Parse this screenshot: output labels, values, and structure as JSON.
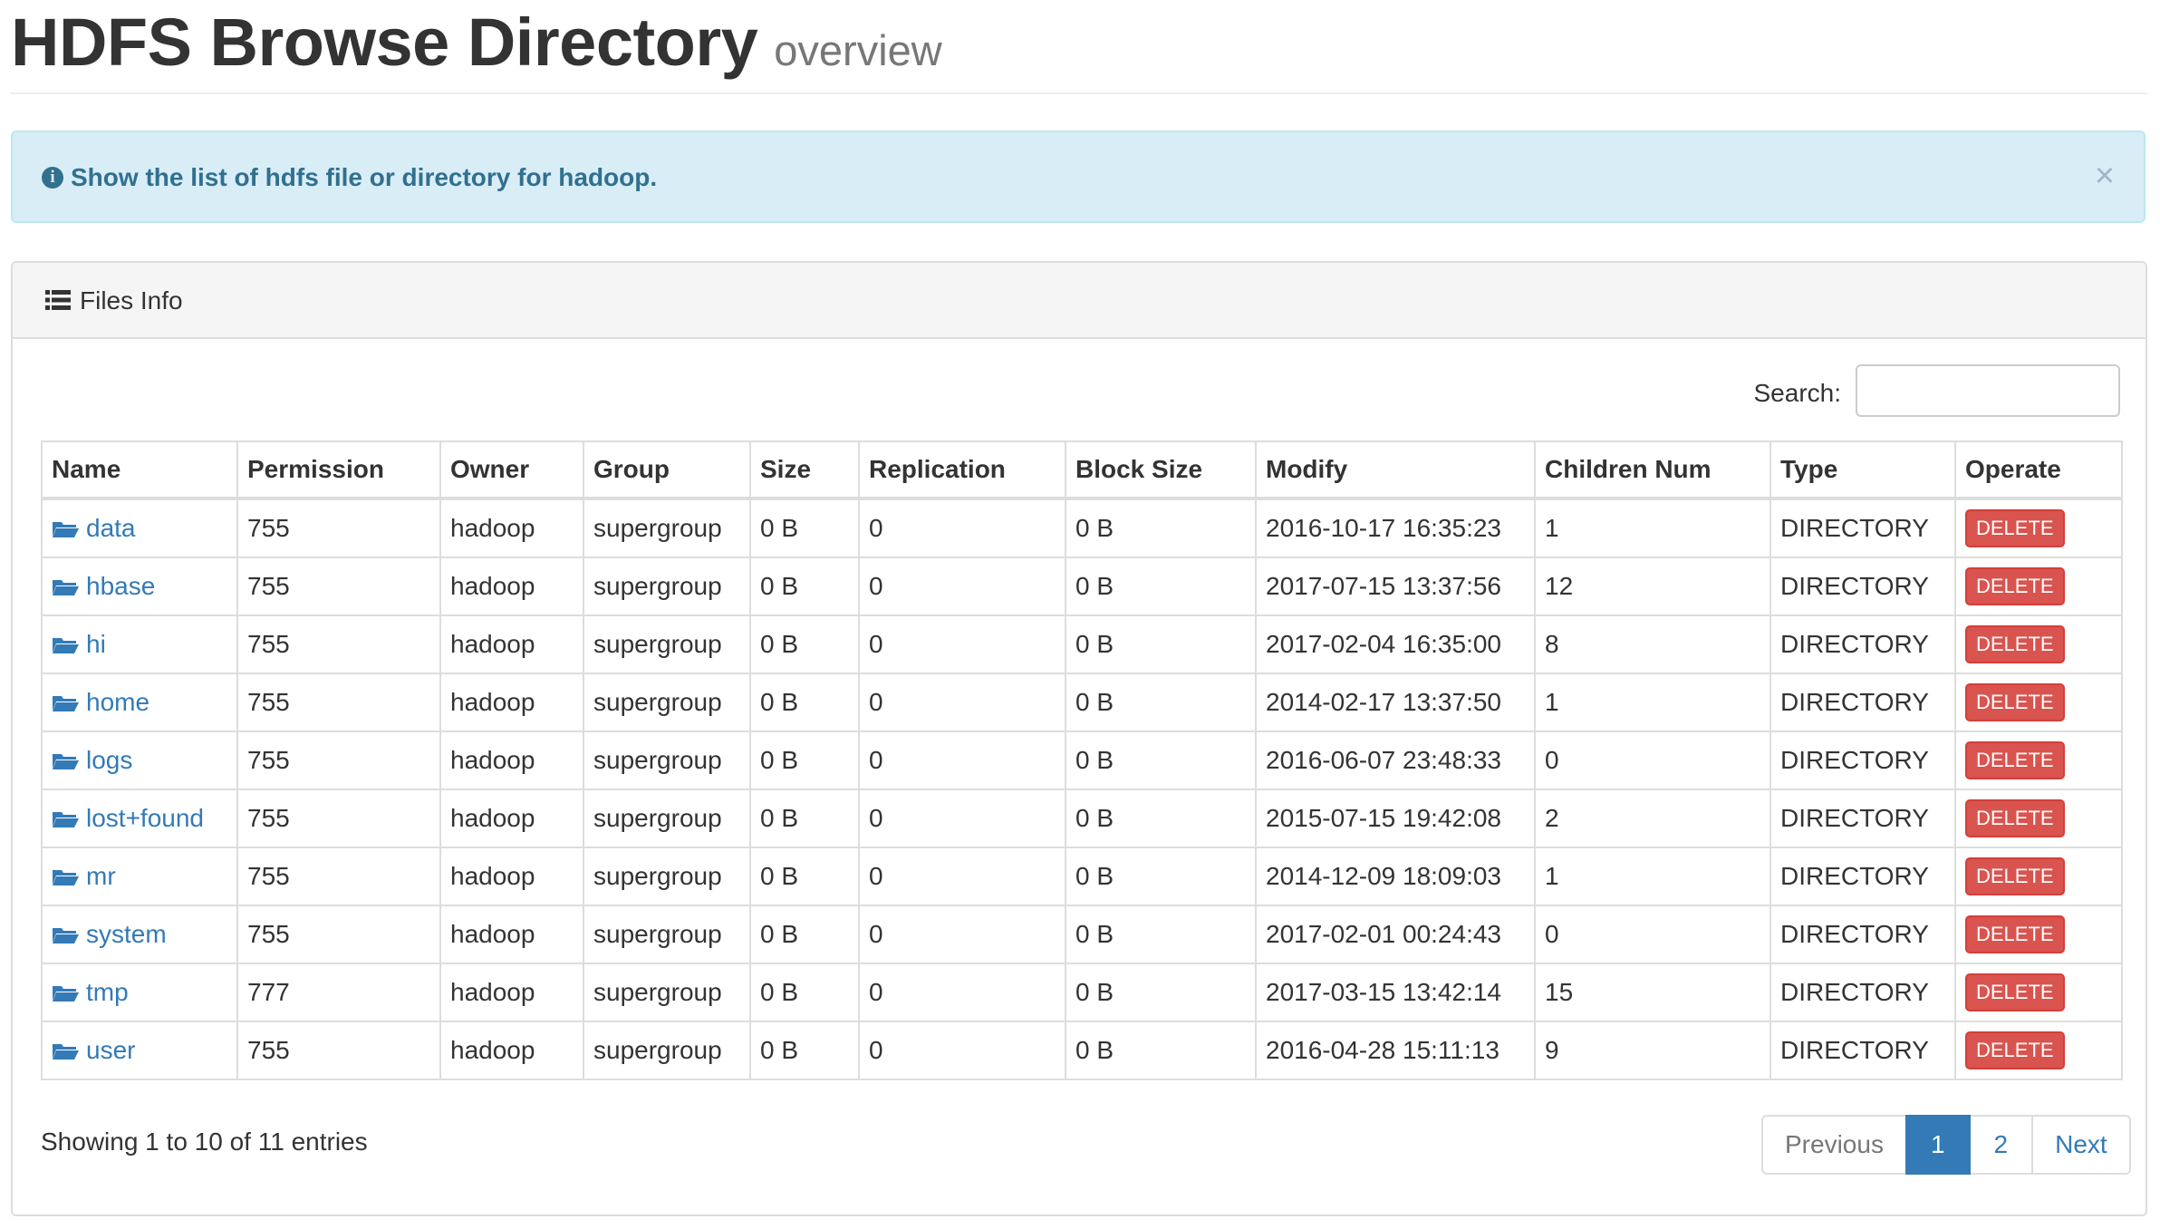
{
  "header": {
    "title": "HDFS Browse Directory",
    "subtitle": "overview"
  },
  "alert": {
    "icon": "info-circle-icon",
    "text": "Show the list of hdfs file or directory for hadoop.",
    "close_label": "×"
  },
  "panel": {
    "icon": "list-icon",
    "title": "Files Info"
  },
  "search": {
    "label": "Search:",
    "value": "",
    "placeholder": ""
  },
  "table": {
    "headers": [
      "Name",
      "Permission",
      "Owner",
      "Group",
      "Size",
      "Replication",
      "Block Size",
      "Modify",
      "Children Num",
      "Type",
      "Operate"
    ],
    "rows": [
      {
        "name": "data",
        "permission": "755",
        "owner": "hadoop",
        "group": "supergroup",
        "size": "0 B",
        "replication": "0",
        "block_size": "0 B",
        "modify": "2016-10-17 16:35:23",
        "children": "1",
        "type": "DIRECTORY",
        "operate": "DELETE"
      },
      {
        "name": "hbase",
        "permission": "755",
        "owner": "hadoop",
        "group": "supergroup",
        "size": "0 B",
        "replication": "0",
        "block_size": "0 B",
        "modify": "2017-07-15 13:37:56",
        "children": "12",
        "type": "DIRECTORY",
        "operate": "DELETE"
      },
      {
        "name": "hi",
        "permission": "755",
        "owner": "hadoop",
        "group": "supergroup",
        "size": "0 B",
        "replication": "0",
        "block_size": "0 B",
        "modify": "2017-02-04 16:35:00",
        "children": "8",
        "type": "DIRECTORY",
        "operate": "DELETE"
      },
      {
        "name": "home",
        "permission": "755",
        "owner": "hadoop",
        "group": "supergroup",
        "size": "0 B",
        "replication": "0",
        "block_size": "0 B",
        "modify": "2014-02-17 13:37:50",
        "children": "1",
        "type": "DIRECTORY",
        "operate": "DELETE"
      },
      {
        "name": "logs",
        "permission": "755",
        "owner": "hadoop",
        "group": "supergroup",
        "size": "0 B",
        "replication": "0",
        "block_size": "0 B",
        "modify": "2016-06-07 23:48:33",
        "children": "0",
        "type": "DIRECTORY",
        "operate": "DELETE"
      },
      {
        "name": "lost+found",
        "permission": "755",
        "owner": "hadoop",
        "group": "supergroup",
        "size": "0 B",
        "replication": "0",
        "block_size": "0 B",
        "modify": "2015-07-15 19:42:08",
        "children": "2",
        "type": "DIRECTORY",
        "operate": "DELETE"
      },
      {
        "name": "mr",
        "permission": "755",
        "owner": "hadoop",
        "group": "supergroup",
        "size": "0 B",
        "replication": "0",
        "block_size": "0 B",
        "modify": "2014-12-09 18:09:03",
        "children": "1",
        "type": "DIRECTORY",
        "operate": "DELETE"
      },
      {
        "name": "system",
        "permission": "755",
        "owner": "hadoop",
        "group": "supergroup",
        "size": "0 B",
        "replication": "0",
        "block_size": "0 B",
        "modify": "2017-02-01 00:24:43",
        "children": "0",
        "type": "DIRECTORY",
        "operate": "DELETE"
      },
      {
        "name": "tmp",
        "permission": "777",
        "owner": "hadoop",
        "group": "supergroup",
        "size": "0 B",
        "replication": "0",
        "block_size": "0 B",
        "modify": "2017-03-15 13:42:14",
        "children": "15",
        "type": "DIRECTORY",
        "operate": "DELETE"
      },
      {
        "name": "user",
        "permission": "755",
        "owner": "hadoop",
        "group": "supergroup",
        "size": "0 B",
        "replication": "0",
        "block_size": "0 B",
        "modify": "2016-04-28 15:11:13",
        "children": "9",
        "type": "DIRECTORY",
        "operate": "DELETE"
      }
    ]
  },
  "footer": {
    "info": "Showing 1 to 10 of 11 entries"
  },
  "pagination": {
    "previous": "Previous",
    "pages": [
      "1",
      "2"
    ],
    "active_page": "1",
    "next": "Next"
  },
  "colors": {
    "link": "#337ab7",
    "danger": "#d9534f",
    "info_bg": "#d9edf7",
    "info_text": "#31708f"
  }
}
